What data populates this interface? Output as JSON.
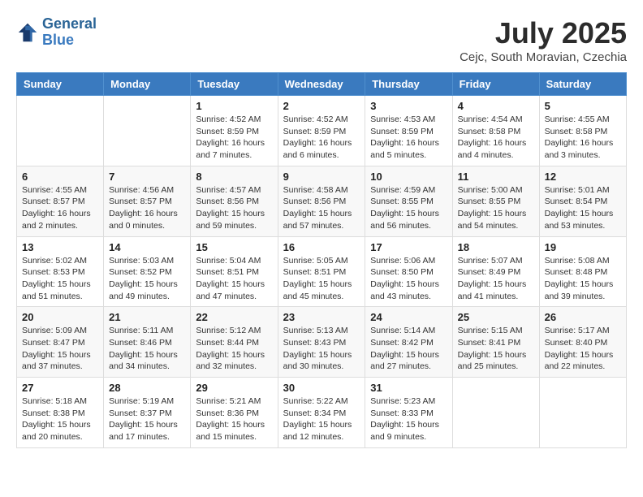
{
  "logo": {
    "line1": "General",
    "line2": "Blue"
  },
  "title": "July 2025",
  "location": "Cejc, South Moravian, Czechia",
  "weekdays": [
    "Sunday",
    "Monday",
    "Tuesday",
    "Wednesday",
    "Thursday",
    "Friday",
    "Saturday"
  ],
  "weeks": [
    [
      {
        "day": "",
        "detail": ""
      },
      {
        "day": "",
        "detail": ""
      },
      {
        "day": "1",
        "detail": "Sunrise: 4:52 AM\nSunset: 8:59 PM\nDaylight: 16 hours\nand 7 minutes."
      },
      {
        "day": "2",
        "detail": "Sunrise: 4:52 AM\nSunset: 8:59 PM\nDaylight: 16 hours\nand 6 minutes."
      },
      {
        "day": "3",
        "detail": "Sunrise: 4:53 AM\nSunset: 8:59 PM\nDaylight: 16 hours\nand 5 minutes."
      },
      {
        "day": "4",
        "detail": "Sunrise: 4:54 AM\nSunset: 8:58 PM\nDaylight: 16 hours\nand 4 minutes."
      },
      {
        "day": "5",
        "detail": "Sunrise: 4:55 AM\nSunset: 8:58 PM\nDaylight: 16 hours\nand 3 minutes."
      }
    ],
    [
      {
        "day": "6",
        "detail": "Sunrise: 4:55 AM\nSunset: 8:57 PM\nDaylight: 16 hours\nand 2 minutes."
      },
      {
        "day": "7",
        "detail": "Sunrise: 4:56 AM\nSunset: 8:57 PM\nDaylight: 16 hours\nand 0 minutes."
      },
      {
        "day": "8",
        "detail": "Sunrise: 4:57 AM\nSunset: 8:56 PM\nDaylight: 15 hours\nand 59 minutes."
      },
      {
        "day": "9",
        "detail": "Sunrise: 4:58 AM\nSunset: 8:56 PM\nDaylight: 15 hours\nand 57 minutes."
      },
      {
        "day": "10",
        "detail": "Sunrise: 4:59 AM\nSunset: 8:55 PM\nDaylight: 15 hours\nand 56 minutes."
      },
      {
        "day": "11",
        "detail": "Sunrise: 5:00 AM\nSunset: 8:55 PM\nDaylight: 15 hours\nand 54 minutes."
      },
      {
        "day": "12",
        "detail": "Sunrise: 5:01 AM\nSunset: 8:54 PM\nDaylight: 15 hours\nand 53 minutes."
      }
    ],
    [
      {
        "day": "13",
        "detail": "Sunrise: 5:02 AM\nSunset: 8:53 PM\nDaylight: 15 hours\nand 51 minutes."
      },
      {
        "day": "14",
        "detail": "Sunrise: 5:03 AM\nSunset: 8:52 PM\nDaylight: 15 hours\nand 49 minutes."
      },
      {
        "day": "15",
        "detail": "Sunrise: 5:04 AM\nSunset: 8:51 PM\nDaylight: 15 hours\nand 47 minutes."
      },
      {
        "day": "16",
        "detail": "Sunrise: 5:05 AM\nSunset: 8:51 PM\nDaylight: 15 hours\nand 45 minutes."
      },
      {
        "day": "17",
        "detail": "Sunrise: 5:06 AM\nSunset: 8:50 PM\nDaylight: 15 hours\nand 43 minutes."
      },
      {
        "day": "18",
        "detail": "Sunrise: 5:07 AM\nSunset: 8:49 PM\nDaylight: 15 hours\nand 41 minutes."
      },
      {
        "day": "19",
        "detail": "Sunrise: 5:08 AM\nSunset: 8:48 PM\nDaylight: 15 hours\nand 39 minutes."
      }
    ],
    [
      {
        "day": "20",
        "detail": "Sunrise: 5:09 AM\nSunset: 8:47 PM\nDaylight: 15 hours\nand 37 minutes."
      },
      {
        "day": "21",
        "detail": "Sunrise: 5:11 AM\nSunset: 8:46 PM\nDaylight: 15 hours\nand 34 minutes."
      },
      {
        "day": "22",
        "detail": "Sunrise: 5:12 AM\nSunset: 8:44 PM\nDaylight: 15 hours\nand 32 minutes."
      },
      {
        "day": "23",
        "detail": "Sunrise: 5:13 AM\nSunset: 8:43 PM\nDaylight: 15 hours\nand 30 minutes."
      },
      {
        "day": "24",
        "detail": "Sunrise: 5:14 AM\nSunset: 8:42 PM\nDaylight: 15 hours\nand 27 minutes."
      },
      {
        "day": "25",
        "detail": "Sunrise: 5:15 AM\nSunset: 8:41 PM\nDaylight: 15 hours\nand 25 minutes."
      },
      {
        "day": "26",
        "detail": "Sunrise: 5:17 AM\nSunset: 8:40 PM\nDaylight: 15 hours\nand 22 minutes."
      }
    ],
    [
      {
        "day": "27",
        "detail": "Sunrise: 5:18 AM\nSunset: 8:38 PM\nDaylight: 15 hours\nand 20 minutes."
      },
      {
        "day": "28",
        "detail": "Sunrise: 5:19 AM\nSunset: 8:37 PM\nDaylight: 15 hours\nand 17 minutes."
      },
      {
        "day": "29",
        "detail": "Sunrise: 5:21 AM\nSunset: 8:36 PM\nDaylight: 15 hours\nand 15 minutes."
      },
      {
        "day": "30",
        "detail": "Sunrise: 5:22 AM\nSunset: 8:34 PM\nDaylight: 15 hours\nand 12 minutes."
      },
      {
        "day": "31",
        "detail": "Sunrise: 5:23 AM\nSunset: 8:33 PM\nDaylight: 15 hours\nand 9 minutes."
      },
      {
        "day": "",
        "detail": ""
      },
      {
        "day": "",
        "detail": ""
      }
    ]
  ]
}
